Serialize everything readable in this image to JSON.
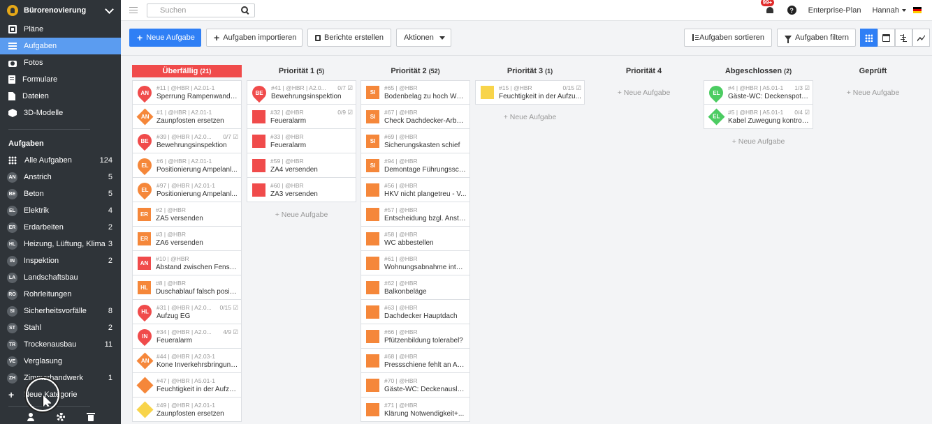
{
  "sidebar": {
    "project": "Bürorenovierung",
    "nav": [
      {
        "label": "Pläne",
        "icon": "plans-icon",
        "active": false
      },
      {
        "label": "Aufgaben",
        "icon": "list-icon",
        "active": true
      },
      {
        "label": "Fotos",
        "icon": "camera-icon",
        "active": false
      },
      {
        "label": "Formulare",
        "icon": "clipboard-icon",
        "active": false
      },
      {
        "label": "Dateien",
        "icon": "file-icon",
        "active": false
      },
      {
        "label": "3D-Modelle",
        "icon": "cube-icon",
        "active": false
      }
    ],
    "section_title": "Aufgaben",
    "categories": [
      {
        "abbr": "",
        "label": "Alle Aufgaben",
        "count": "124",
        "color": ""
      },
      {
        "abbr": "AN",
        "label": "Anstrich",
        "count": "5"
      },
      {
        "abbr": "BE",
        "label": "Beton",
        "count": "5"
      },
      {
        "abbr": "EL",
        "label": "Elektrik",
        "count": "4"
      },
      {
        "abbr": "ER",
        "label": "Erdarbeiten",
        "count": "2"
      },
      {
        "abbr": "HL",
        "label": "Heizung, Lüftung, Klima",
        "count": "3"
      },
      {
        "abbr": "IN",
        "label": "Inspektion",
        "count": "2"
      },
      {
        "abbr": "LA",
        "label": "Landschaftsbau",
        "count": ""
      },
      {
        "abbr": "RO",
        "label": "Rohrleitungen",
        "count": ""
      },
      {
        "abbr": "SI",
        "label": "Sicherheitsvorfälle",
        "count": "8"
      },
      {
        "abbr": "ST",
        "label": "Stahl",
        "count": "2"
      },
      {
        "abbr": "TR",
        "label": "Trockenausbau",
        "count": "11"
      },
      {
        "abbr": "VE",
        "label": "Verglasung",
        "count": ""
      },
      {
        "abbr": "ZH",
        "label": "Zimmerhandwerk",
        "count": "1"
      }
    ],
    "new_category": "Neue Kategorie"
  },
  "topbar": {
    "search_placeholder": "Suchen",
    "notifications": "99+",
    "help": "?",
    "plan": "Enterprise-Plan",
    "user": "Hannah"
  },
  "toolbar": {
    "new_task": "Neue Aufgabe",
    "import": "Aufgaben importieren",
    "reports": "Berichte erstellen",
    "actions": "Aktionen",
    "sort": "Aufgaben sortieren",
    "filter": "Aufgaben filtern"
  },
  "colors": {
    "red": "#f04b4b",
    "orange": "#f5873a",
    "yellow": "#f8d44a",
    "green": "#4ccc62",
    "accent": "#2f7ff5"
  },
  "new_task_label": "+ Neue Aufgabe",
  "columns": [
    {
      "title": "Überfällig",
      "count": "(21)",
      "overdue": true,
      "show_new": false,
      "cards": [
        {
          "meta": "#11 | @HBR | A2.01-1",
          "check": "",
          "title": "Sperrung Rampenwand/T...",
          "shape": "pin",
          "color": "red",
          "abbr": "AN"
        },
        {
          "meta": "#1 | @HBR | A2.01-1",
          "check": "",
          "title": "Zaunpfosten ersetzen",
          "shape": "dia",
          "color": "orange",
          "abbr": "AN"
        },
        {
          "meta": "#39 | @HBR | A2.0...",
          "check": "0/7 ☑",
          "title": "Bewehrungsinspektion",
          "shape": "pin",
          "color": "red",
          "abbr": "BE"
        },
        {
          "meta": "#6 | @HBR | A2.01-1",
          "check": "",
          "title": "Positionierung Ampelanl...",
          "shape": "pin",
          "color": "orange",
          "abbr": "EL"
        },
        {
          "meta": "#97 | @HBR | A2.01-1",
          "check": "",
          "title": "Positionierung Ampelanl...",
          "shape": "pin",
          "color": "orange",
          "abbr": "EL"
        },
        {
          "meta": "#2 | @HBR",
          "check": "",
          "title": "ZA5 versenden",
          "shape": "sq",
          "color": "orange",
          "abbr": "ER"
        },
        {
          "meta": "#3 | @HBR",
          "check": "",
          "title": "ZA6 versenden",
          "shape": "sq",
          "color": "orange",
          "abbr": "ER"
        },
        {
          "meta": "#10 | @HBR",
          "check": "",
          "title": "Abstand zwischen Fenste...",
          "shape": "sq",
          "color": "red",
          "abbr": "AN"
        },
        {
          "meta": "#8 | @HBR",
          "check": "",
          "title": "Duschablauf falsch positi...",
          "shape": "sq",
          "color": "orange",
          "abbr": "HL"
        },
        {
          "meta": "#31 | @HBR | A2.0...",
          "check": "0/15 ☑",
          "title": "Aufzug EG",
          "shape": "pin",
          "color": "red",
          "abbr": "HL"
        },
        {
          "meta": "#34 | @HBR | A2.0...",
          "check": "4/9 ☑",
          "title": "Feueralarm",
          "shape": "pin",
          "color": "red",
          "abbr": "IN"
        },
        {
          "meta": "#44 | @HBR | A2.03-1",
          "check": "",
          "title": "Kone Inverkehrsbringung...",
          "shape": "dia",
          "color": "orange",
          "abbr": "AN"
        },
        {
          "meta": "#47 | @HBR | A5.01-1",
          "check": "",
          "title": "Feuchtigkeit in der Aufzu...",
          "shape": "dia",
          "color": "orange",
          "abbr": ""
        },
        {
          "meta": "#49 | @HBR | A2.01-1",
          "check": "",
          "title": "Zaunpfosten ersetzen",
          "shape": "dia",
          "color": "yellow",
          "abbr": ""
        }
      ]
    },
    {
      "title": "Priorität 1",
      "count": "(5)",
      "overdue": false,
      "show_new": true,
      "cards": [
        {
          "meta": "#41 | @HBR | A2.0...",
          "check": "0/7 ☑",
          "title": "Bewehrungsinspektion",
          "shape": "pin",
          "color": "red",
          "abbr": "BE"
        },
        {
          "meta": "#32 | @HBR",
          "check": "0/9 ☑",
          "title": "Feueralarm",
          "shape": "sq",
          "color": "red",
          "abbr": ""
        },
        {
          "meta": "#33 | @HBR",
          "check": "",
          "title": "Feueralarm",
          "shape": "sq",
          "color": "red",
          "abbr": ""
        },
        {
          "meta": "#59 | @HBR",
          "check": "",
          "title": "ZA4 versenden",
          "shape": "sq",
          "color": "red",
          "abbr": ""
        },
        {
          "meta": "#60 | @HBR",
          "check": "",
          "title": "ZA3 versenden",
          "shape": "sq",
          "color": "red",
          "abbr": ""
        }
      ]
    },
    {
      "title": "Priorität 2",
      "count": "(52)",
      "overdue": false,
      "show_new": false,
      "cards": [
        {
          "meta": "#65 | @HBR",
          "check": "",
          "title": "Bodenbelag zu hoch WE5...",
          "shape": "sq",
          "color": "orange",
          "abbr": "SI"
        },
        {
          "meta": "#67 | @HBR",
          "check": "",
          "title": "Check Dachdecker-Arbei...",
          "shape": "sq",
          "color": "orange",
          "abbr": "SI"
        },
        {
          "meta": "#69 | @HBR",
          "check": "",
          "title": "Sicherungskasten schief",
          "shape": "sq",
          "color": "orange",
          "abbr": "SI"
        },
        {
          "meta": "#94 | @HBR",
          "check": "",
          "title": "Demontage Führungsschi...",
          "shape": "sq",
          "color": "orange",
          "abbr": "SI"
        },
        {
          "meta": "#56 | @HBR",
          "check": "",
          "title": "HKV nicht plangetreu - V...",
          "shape": "sq",
          "color": "orange",
          "abbr": ""
        },
        {
          "meta": "#57 | @HBR",
          "check": "",
          "title": "Entscheidung bzgl. Anstri...",
          "shape": "sq",
          "color": "orange",
          "abbr": ""
        },
        {
          "meta": "#58 | @HBR",
          "check": "",
          "title": "WC abbestellen",
          "shape": "sq",
          "color": "orange",
          "abbr": ""
        },
        {
          "meta": "#61 | @HBR",
          "check": "",
          "title": "Wohnungsabnahme inter...",
          "shape": "sq",
          "color": "orange",
          "abbr": ""
        },
        {
          "meta": "#62 | @HBR",
          "check": "",
          "title": "Balkonbeläge",
          "shape": "sq",
          "color": "orange",
          "abbr": ""
        },
        {
          "meta": "#63 | @HBR",
          "check": "",
          "title": "Dachdecker Hauptdach",
          "shape": "sq",
          "color": "orange",
          "abbr": ""
        },
        {
          "meta": "#66 | @HBR",
          "check": "",
          "title": "Pfützenbildung tolerabel?",
          "shape": "sq",
          "color": "orange",
          "abbr": ""
        },
        {
          "meta": "#68 | @HBR",
          "check": "",
          "title": "Pressschiene fehlt an Ab...",
          "shape": "sq",
          "color": "orange",
          "abbr": ""
        },
        {
          "meta": "#70 | @HBR",
          "check": "",
          "title": "Gäste-WC: Deckenauslas...",
          "shape": "sq",
          "color": "orange",
          "abbr": ""
        },
        {
          "meta": "#71 | @HBR",
          "check": "",
          "title": "Klärung Notwendigkeit+...",
          "shape": "sq",
          "color": "orange",
          "abbr": ""
        }
      ]
    },
    {
      "title": "Priorität 3",
      "count": "(1)",
      "overdue": false,
      "show_new": true,
      "cards": [
        {
          "meta": "#15 | @HBR",
          "check": "0/15 ☑",
          "title": "Feuchtigkeit in der Aufzu...",
          "shape": "sq",
          "color": "yellow",
          "abbr": ""
        }
      ]
    },
    {
      "title": "Priorität 4",
      "count": "",
      "overdue": false,
      "show_new": true,
      "cards": []
    },
    {
      "title": "Abgeschlossen",
      "count": "(2)",
      "overdue": false,
      "show_new": true,
      "cards": [
        {
          "meta": "#4 | @HBR | A5.01-1",
          "check": "1/3 ☑",
          "title": "Gäste-WC: Deckenspot ü...",
          "shape": "pin",
          "color": "green",
          "abbr": "EL"
        },
        {
          "meta": "#5 | @HBR | A5.01-1",
          "check": "0/4 ☑",
          "title": "Kabel Zuwegung kontroll...",
          "shape": "dia",
          "color": "green",
          "abbr": "EL"
        }
      ]
    },
    {
      "title": "Geprüft",
      "count": "",
      "overdue": false,
      "show_new": true,
      "cards": []
    }
  ]
}
